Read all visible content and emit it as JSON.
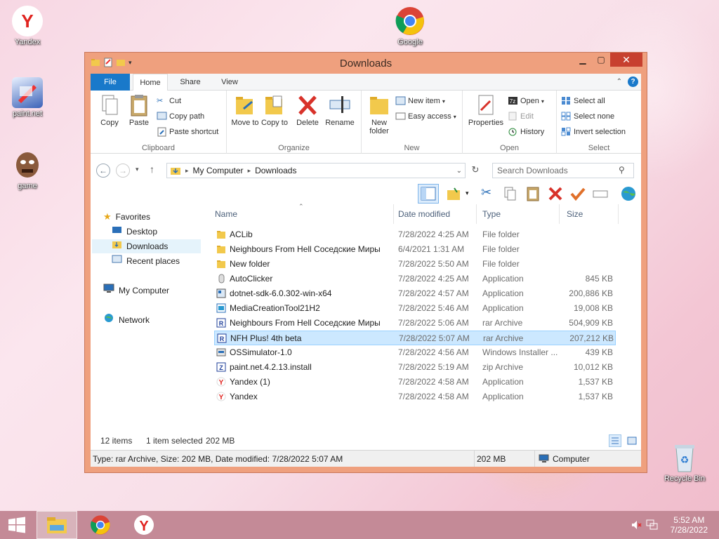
{
  "desktop": {
    "icons": [
      {
        "label": "Yandex"
      },
      {
        "label": "paint.net"
      },
      {
        "label": "game"
      },
      {
        "label": "Google"
      },
      {
        "label": "Recycle Bin"
      }
    ]
  },
  "window": {
    "title": "Downloads",
    "tabs": {
      "file": "File",
      "home": "Home",
      "share": "Share",
      "view": "View"
    },
    "ribbon": {
      "clipboard": {
        "label": "Clipboard",
        "copy": "Copy",
        "paste": "Paste",
        "cut": "Cut",
        "copy_path": "Copy path",
        "paste_shortcut": "Paste shortcut"
      },
      "organize": {
        "label": "Organize",
        "move_to": "Move to",
        "copy_to": "Copy to",
        "delete": "Delete",
        "rename": "Rename"
      },
      "new": {
        "label": "New",
        "new_folder": "New folder",
        "new_item": "New item",
        "easy_access": "Easy access"
      },
      "open": {
        "label": "Open",
        "properties": "Properties",
        "open": "Open",
        "edit": "Edit",
        "history": "History"
      },
      "select": {
        "label": "Select",
        "select_all": "Select all",
        "select_none": "Select none",
        "invert_selection": "Invert selection"
      }
    },
    "address": {
      "crumbs": [
        "My Computer",
        "Downloads"
      ],
      "search_placeholder": "Search Downloads"
    },
    "nav": {
      "favorites": "Favorites",
      "desktop": "Desktop",
      "downloads": "Downloads",
      "recent": "Recent places",
      "computer": "My Computer",
      "network": "Network"
    },
    "columns": {
      "name": "Name",
      "date": "Date modified",
      "type": "Type",
      "size": "Size"
    },
    "files": [
      {
        "name": "ACLib",
        "date": "7/28/2022 4:25 AM",
        "type": "File folder",
        "size": "",
        "icon": "folder-icon"
      },
      {
        "name": "Neighbours From Hell Соседские Миры",
        "date": "6/4/2021 1:31 AM",
        "type": "File folder",
        "size": "",
        "icon": "folder-icon"
      },
      {
        "name": "New folder",
        "date": "7/28/2022 5:50 AM",
        "type": "File folder",
        "size": "",
        "icon": "folder-icon"
      },
      {
        "name": "AutoClicker",
        "date": "7/28/2022 4:25 AM",
        "type": "Application",
        "size": "845 KB",
        "icon": "mouse-icon"
      },
      {
        "name": "dotnet-sdk-6.0.302-win-x64",
        "date": "7/28/2022 4:57 AM",
        "type": "Application",
        "size": "200,886 KB",
        "icon": "installer-icon"
      },
      {
        "name": "MediaCreationTool21H2",
        "date": "7/28/2022 5:46 AM",
        "type": "Application",
        "size": "19,008 KB",
        "icon": "media-tool-icon"
      },
      {
        "name": "Neighbours From Hell Соседские Миры",
        "date": "7/28/2022 5:06 AM",
        "type": "rar Archive",
        "size": "504,909 KB",
        "icon": "rar-icon"
      },
      {
        "name": "NFH Plus! 4th beta",
        "date": "7/28/2022 5:07 AM",
        "type": "rar Archive",
        "size": "207,212 KB",
        "icon": "rar-icon"
      },
      {
        "name": "OSSimulator-1.0",
        "date": "7/28/2022 4:56 AM",
        "type": "Windows Installer ...",
        "size": "439 KB",
        "icon": "msi-icon"
      },
      {
        "name": "paint.net.4.2.13.install",
        "date": "7/28/2022 5:19 AM",
        "type": "zip Archive",
        "size": "10,012 KB",
        "icon": "zip-icon"
      },
      {
        "name": "Yandex (1)",
        "date": "7/28/2022 4:58 AM",
        "type": "Application",
        "size": "1,537 KB",
        "icon": "yandex-icon"
      },
      {
        "name": "Yandex",
        "date": "7/28/2022 4:58 AM",
        "type": "Application",
        "size": "1,537 KB",
        "icon": "yandex-icon"
      }
    ],
    "selected_index": 7,
    "status": {
      "items": "12 items",
      "selected": "1 item selected",
      "selected_size": "202 MB",
      "details": "Type: rar Archive, Size: 202 MB, Date modified: 7/28/2022 5:07 AM",
      "size2": "202 MB",
      "location": "Computer"
    }
  },
  "taskbar": {
    "time": "5:52 AM",
    "date": "7/28/2022"
  },
  "colors": {
    "accent": "#1979ca",
    "frame": "#efa07e",
    "close": "#c7402f",
    "selection": "#cce8ff"
  }
}
